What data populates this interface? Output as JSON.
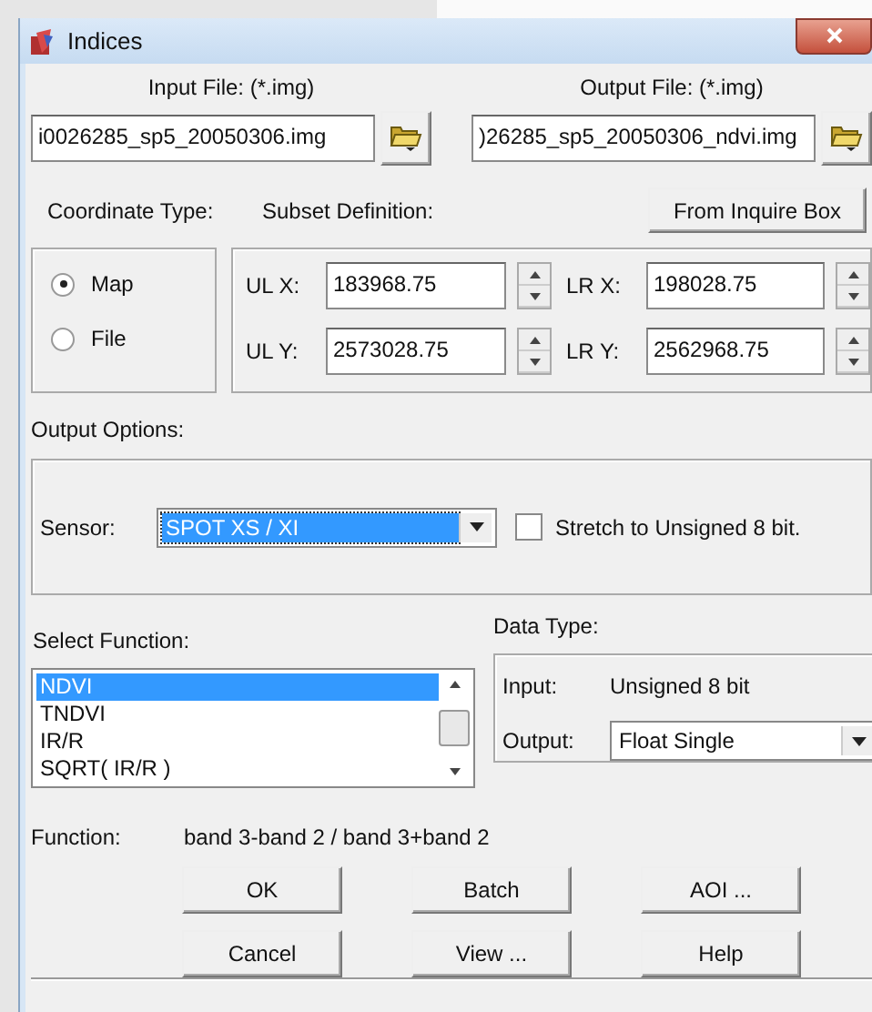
{
  "window": {
    "title": "Indices"
  },
  "input_file": {
    "label": "Input File: (*.img)",
    "value": "i0026285_sp5_20050306.img"
  },
  "output_file": {
    "label": "Output File: (*.img)",
    "value": ")26285_sp5_20050306_ndvi.img"
  },
  "coordinate_type": {
    "label": "Coordinate Type:",
    "options": [
      {
        "label": "Map",
        "selected": true
      },
      {
        "label": "File",
        "selected": false
      }
    ]
  },
  "subset": {
    "label": "Subset Definition:",
    "button": "From Inquire Box",
    "fields": [
      {
        "label": "UL X:",
        "value": "183968.75"
      },
      {
        "label": "LR X:",
        "value": "198028.75"
      },
      {
        "label": "UL Y:",
        "value": "2573028.75"
      },
      {
        "label": "LR Y:",
        "value": "2562968.75"
      }
    ]
  },
  "output_options": {
    "label": "Output Options:",
    "sensor_label": "Sensor:",
    "sensor": "SPOT XS / XI",
    "stretch": {
      "label": "Stretch to Unsigned 8 bit.",
      "checked": false
    }
  },
  "select_function": {
    "label": "Select Function:",
    "items": [
      {
        "label": "NDVI",
        "selected": true
      },
      {
        "label": "TNDVI",
        "selected": false
      },
      {
        "label": "IR/R",
        "selected": false
      },
      {
        "label": "SQRT( IR/R )",
        "selected": false
      }
    ]
  },
  "data_type": {
    "label": "Data Type:",
    "input_label": "Input:",
    "input_value": "Unsigned 8 bit",
    "output_label": "Output:",
    "output_value": "Float Single"
  },
  "function": {
    "label": "Function:",
    "value": "band 3-band 2 / band 3+band 2"
  },
  "buttons": [
    "OK",
    "Batch",
    "AOI ...",
    "Cancel",
    "View ...",
    "Help"
  ]
}
